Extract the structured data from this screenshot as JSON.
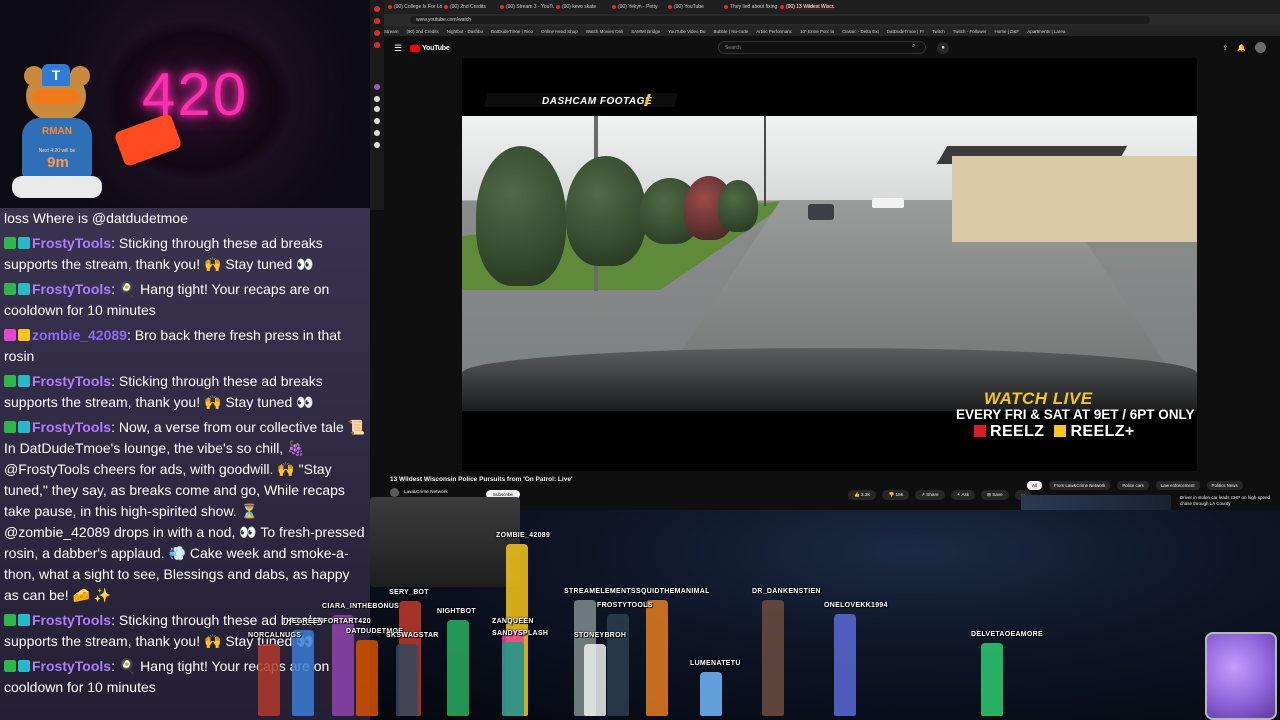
{
  "overlay": {
    "bear_cap_letter": "T",
    "bear_shirt": "RMAN",
    "bear_shirt_sub": "Next 4:20 will be",
    "bear_timer": "9m",
    "neon_sign": "420"
  },
  "chat": {
    "partial_line": "loss Where is @datdudetmoe",
    "messages": [
      {
        "user": "FrostyTools",
        "badges": [
          "green",
          "cyan"
        ],
        "text": ": Sticking through these ad breaks supports the stream, thank you! 🙌 Stay tuned 👀"
      },
      {
        "user": "FrostyTools",
        "badges": [
          "green",
          "cyan"
        ],
        "text": ": 🍳 Hang tight! Your recaps are on cooldown for 10 minutes"
      },
      {
        "user": "zombie_42089",
        "badges": [
          "pink",
          "crown"
        ],
        "text": ": Bro back there fresh press in that rosin"
      },
      {
        "user": "FrostyTools",
        "badges": [
          "green",
          "cyan"
        ],
        "text": ": Sticking through these ad breaks supports the stream, thank you! 🙌 Stay tuned 👀"
      },
      {
        "user": "FrostyTools",
        "badges": [
          "green",
          "cyan"
        ],
        "text": ": Now, a verse from our collective tale 📜 In DatDudeTmoe's lounge, the vibe's so chill, 🍇 @FrostyTools cheers for ads, with goodwill. 🙌 \"Stay tuned,\" they say, as breaks come and go, While recaps take pause, in this high-spirited show. ⏳ @zombie_42089 drops in with a nod, 👀 To fresh-pressed rosin, a dabber's applaud. 💨 Cake week and smoke-a-thon, what a sight to see, Blessings and dabs, as happy as can be! 🧀 ✨"
      },
      {
        "user": "FrostyTools",
        "badges": [
          "green",
          "cyan"
        ],
        "text": ": Sticking through these ad breaks supports the stream, thank you! 🙌 Stay tuned 👀"
      },
      {
        "user": "FrostyTools",
        "badges": [
          "green",
          "cyan"
        ],
        "text": ": 🍳 Hang tight! Your recaps are on cooldown for 10 minutes"
      }
    ]
  },
  "browser": {
    "tabs": [
      "(90) College Is For Lovers",
      "(90) 2nd Credits",
      "(90) Stream 3 - YouTube",
      "(90) kevo skate",
      "(90) Yekyn - Petty",
      "(90) YouTube",
      "They lied about fixing",
      "(90) 13 Wildest Wisco"
    ],
    "url": "www.youtube.com/watch",
    "bookmarks": [
      "Stream",
      "(90) 2nd Credits",
      "Nightbot - Dashbo",
      "DatDudeTmoe | Rico",
      "Online Head Shop",
      "Watch Movies Onli",
      "SAMMI Bridge",
      "YouTube Video Do",
      "Bubble | No-code",
      "Artisc Performanc",
      "10* Entre Porc la",
      "Classic - Delta Ext",
      "DatDudeTmoe | Fr",
      "Twitch",
      "Twitch - Follower",
      "Home | D&F",
      "Apartments | Larea"
    ],
    "yt_logo": "YouTube",
    "search_placeholder": "Search"
  },
  "video": {
    "dashcam_label": "DASHCAM FOOTAGE",
    "watch_live": "WATCH LIVE",
    "schedule": "EVERY FRI & SAT AT 9ET / 6PT ONLY ON",
    "network": "REELZ",
    "network_plus": "REELZ+",
    "title": "13 Wildest Wisconsin Police Pursuits from 'On Patrol: Live'",
    "channel": "Law&Crime Network",
    "subscribe": "Subscribe",
    "likes": "3.3K",
    "dislike_count": "156",
    "share": "Share",
    "ask": "Ask",
    "save": "Save"
  },
  "recommendations": {
    "chips": [
      "All",
      "From Law&Crime Network",
      "Police cars",
      "Law enforcement",
      "Politics News"
    ],
    "first_title": "Driver in stolen car leads CHP on high-speed chase through LA County"
  },
  "stage": {
    "names": [
      "ZOMBIE_42089",
      "SERY_BOT",
      "THEGREENFORTART420",
      "CIARA_INTHEBONUS",
      "NIGHTBOT",
      "STREAMELEMENTS",
      "SQUIDTHEMANIMAL",
      "FROSTYTOOLS",
      "DR_DANKENSTIEN",
      "ONELOVEKK1994",
      "DELVETAOEAMORE",
      "NORCALNUGS",
      "DATDUDETMOE",
      "SKSWAGSTAR",
      "ZANQUEEN",
      "SANDYSPLASH",
      "STONEYBROH",
      "LUMENATETU"
    ]
  }
}
